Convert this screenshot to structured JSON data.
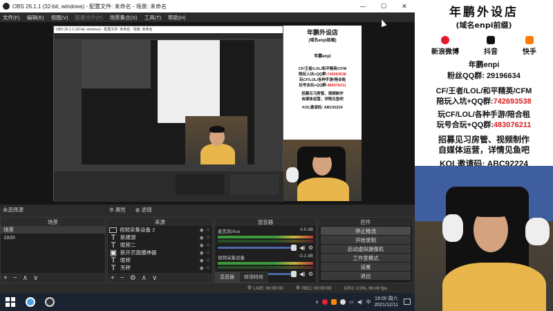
{
  "window": {
    "title": "OBS 26.1.1 (32-bit, windows) - 配置文件: 未命名 - 场景: 未命名",
    "minimize": "—",
    "maximize": "☐",
    "close": "✕"
  },
  "menu": [
    "文件(F)",
    "编辑(E)",
    "视图(V)",
    "配置文件(P)",
    "场景集合(S)",
    "工具(T)",
    "帮助(H)"
  ],
  "dock": {
    "no_source": "未选择源",
    "properties": "属性",
    "filters": "滤镜"
  },
  "scenes": {
    "header": "场景",
    "items": [
      "场景",
      "1920"
    ]
  },
  "sources": {
    "header": "来源",
    "items": [
      {
        "name": "视频采集设备 2",
        "icon": "camera-icon"
      },
      {
        "name": "新建源",
        "icon": "text-icon"
      },
      {
        "name": "昵称二",
        "icon": "text-icon"
      },
      {
        "name": "新开页面播神器",
        "icon": "image-icon"
      },
      {
        "name": "昵称",
        "icon": "text-icon"
      },
      {
        "name": "天秤",
        "icon": "text-icon"
      }
    ]
  },
  "mixer": {
    "header": "混音器",
    "channels": [
      {
        "name": "麦克风/Aux",
        "level": "0.0 dB"
      },
      {
        "name": "视频采集设备",
        "level": "-0.1 dB"
      }
    ],
    "tabs": [
      "混音器",
      "转场特效"
    ]
  },
  "controls": {
    "header": "控件",
    "buttons": [
      "停止推流",
      "开始录制",
      "启动虚拟摄像机",
      "工作室模式",
      "设置",
      "退出"
    ]
  },
  "status": {
    "live": "LIVE: 00:00:00",
    "rec": "REC: 00:00:00",
    "cpu": "CPU: 2.0%, 60.00 fps"
  },
  "taskbar": {
    "time": "19:00 周六",
    "date": "2021/12/11",
    "ime": "中"
  },
  "overlay": {
    "shop": "年鹏外设店",
    "domain": "(域名enpi前缀)",
    "socials": [
      {
        "label": "新浪微博",
        "color": "#e6162d"
      },
      {
        "label": "抖音",
        "color": "#111111"
      },
      {
        "label": "快手",
        "color": "#ff7a00"
      }
    ],
    "nickname": "年鹏enpi",
    "fans_label": "粉丝QQ群:",
    "fans_number": "29196634",
    "line1": "CF/王者/LOL/和平精英/CFM",
    "line2_label": "陪玩入坑+QQ群:",
    "line2_number": "742693538",
    "line3": "玩CF/LOL/各种手游/陪合租",
    "line4_label": "玩号合玩+QQ群:",
    "line4_number": "483076211",
    "line5": "招募见习房管、视频制作",
    "line6": "自媒体运营，详情见鱼吧",
    "line7": "KOL邀请码: ABC92224",
    "red": "#d8201d"
  },
  "nested": {
    "title": "OBS 26.1.1 (32-bit, windows) - 配置文件: 未命名 - 场景: 未命名"
  }
}
